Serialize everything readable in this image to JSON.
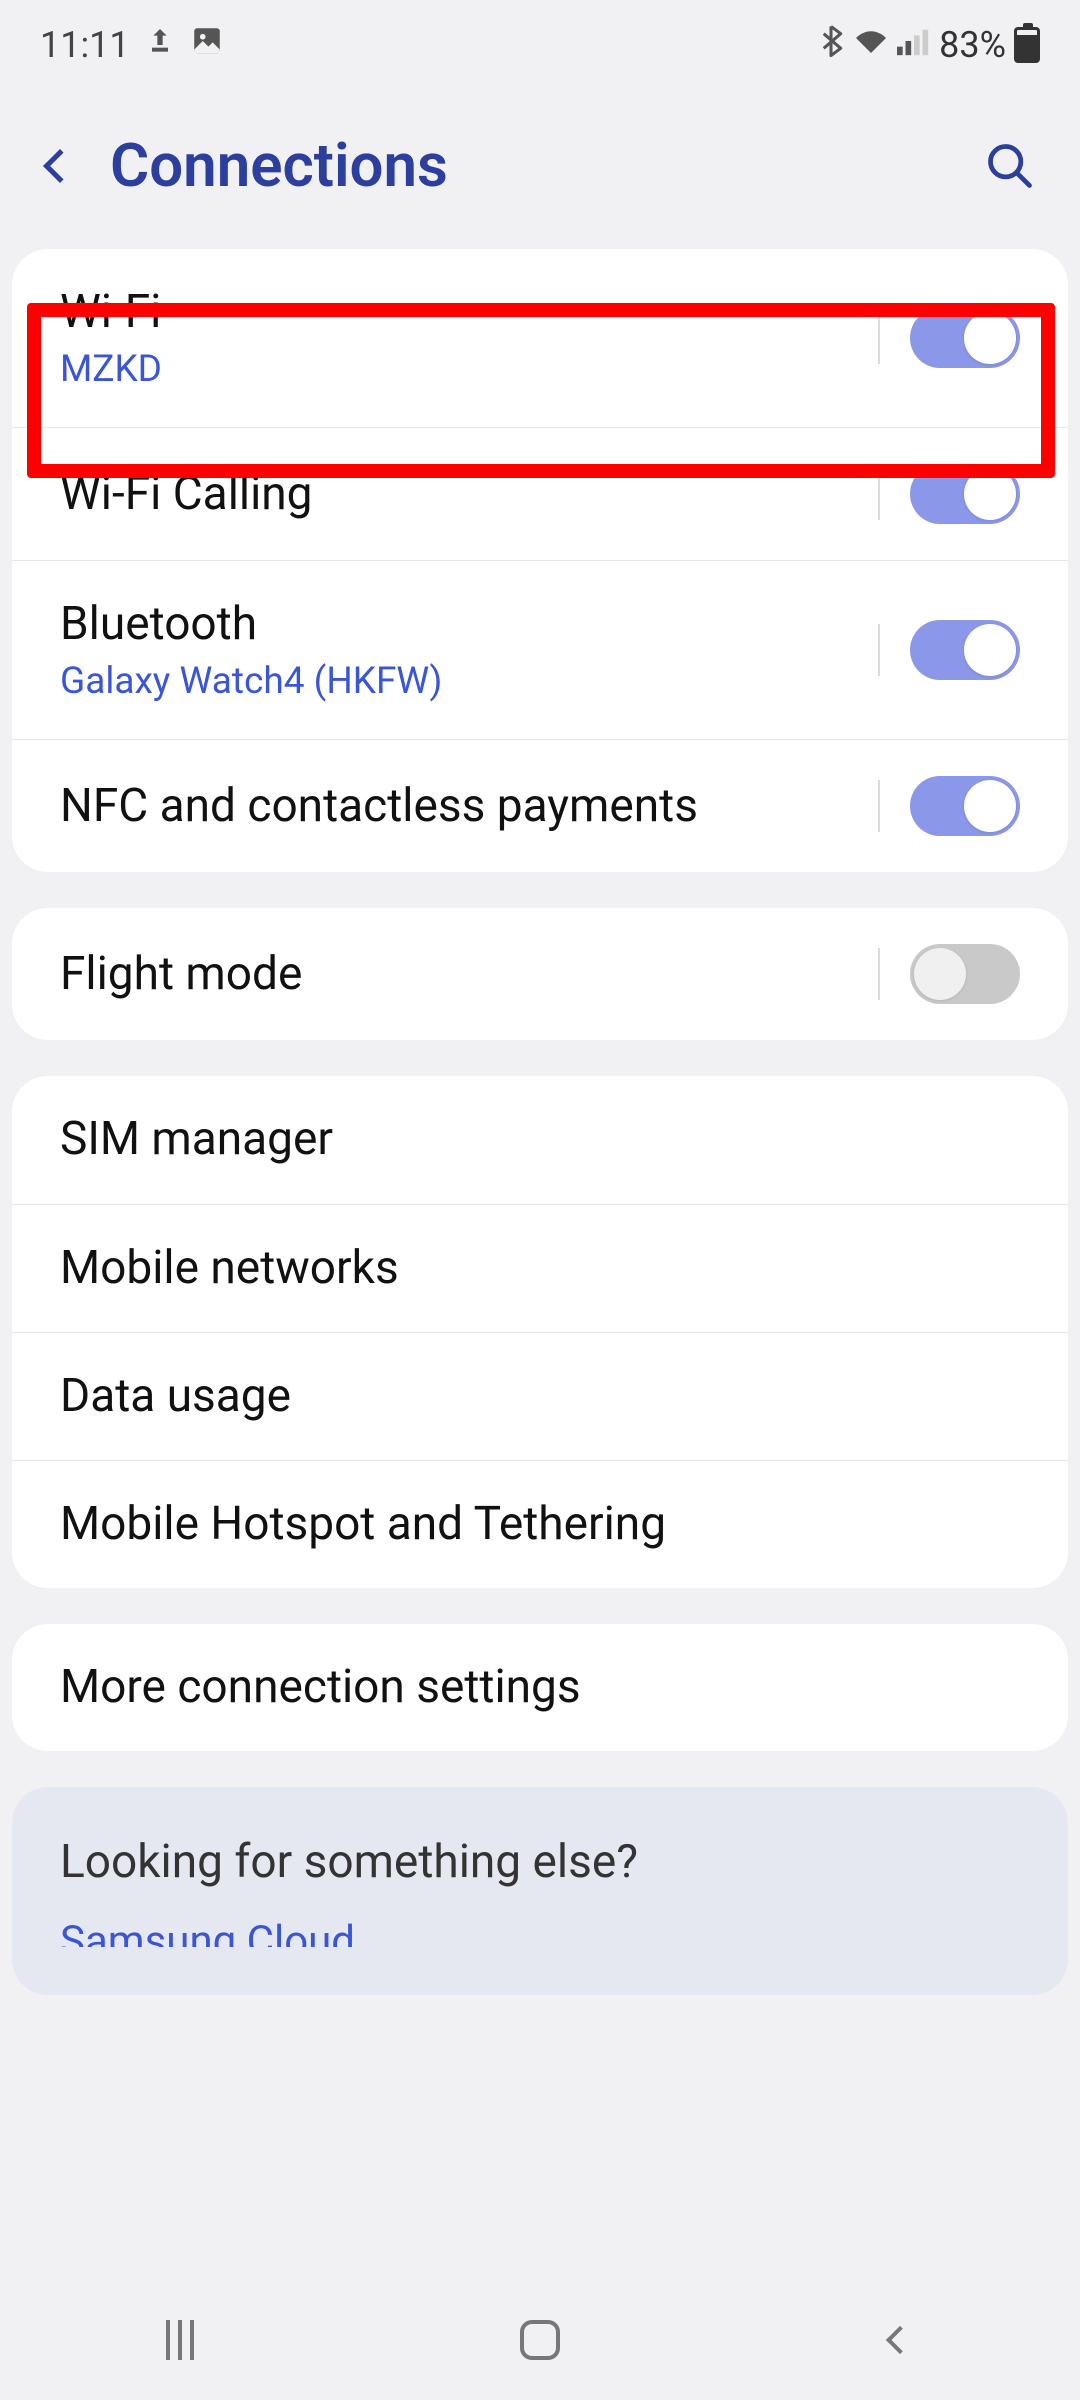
{
  "status": {
    "time": "11:11",
    "battery": "83%"
  },
  "header": {
    "title": "Connections"
  },
  "groups": [
    {
      "rows": [
        {
          "title": "Wi-Fi",
          "subtitle": "MZKD",
          "toggle": "on",
          "highlighted": true,
          "name": "wifi-row"
        },
        {
          "title": "Wi-Fi Calling",
          "subtitle": null,
          "toggle": "on",
          "name": "wifi-calling-row"
        },
        {
          "title": "Bluetooth",
          "subtitle": "Galaxy Watch4 (HKFW)",
          "toggle": "on",
          "name": "bluetooth-row"
        },
        {
          "title": "NFC and contactless payments",
          "subtitle": null,
          "toggle": "on",
          "name": "nfc-row"
        }
      ]
    },
    {
      "rows": [
        {
          "title": "Flight mode",
          "subtitle": null,
          "toggle": "off",
          "name": "flight-mode-row"
        }
      ]
    },
    {
      "rows": [
        {
          "title": "SIM manager",
          "subtitle": null,
          "toggle": null,
          "name": "sim-manager-row"
        },
        {
          "title": "Mobile networks",
          "subtitle": null,
          "toggle": null,
          "name": "mobile-networks-row"
        },
        {
          "title": "Data usage",
          "subtitle": null,
          "toggle": null,
          "name": "data-usage-row"
        },
        {
          "title": "Mobile Hotspot and Tethering",
          "subtitle": null,
          "toggle": null,
          "name": "hotspot-tethering-row"
        }
      ]
    },
    {
      "rows": [
        {
          "title": "More connection settings",
          "subtitle": null,
          "toggle": null,
          "name": "more-connection-row"
        }
      ]
    }
  ],
  "footer": {
    "title": "Looking for something else?",
    "link": "Samsung Cloud"
  }
}
